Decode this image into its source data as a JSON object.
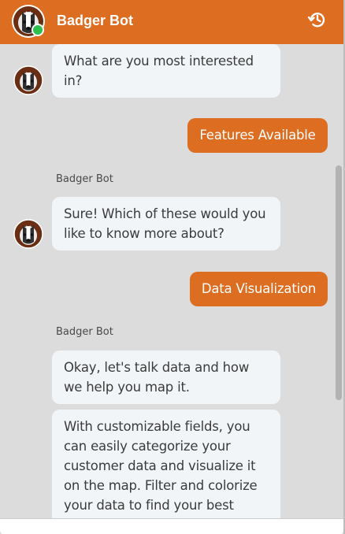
{
  "header": {
    "title": "Badger Bot",
    "icons": {
      "avatar": "badger-avatar",
      "status": "online-status-dot",
      "history": "history-clock-icon"
    },
    "colors": {
      "accent": "#dc6d21",
      "online": "#2cbf4e"
    }
  },
  "messages": [
    {
      "from": "bot",
      "text": "What are you most interested in?"
    },
    {
      "from": "user",
      "text": "Features Available"
    },
    {
      "from": "bot",
      "sender": "Badger Bot",
      "text": "Sure! Which of these would you like to know more about?"
    },
    {
      "from": "user",
      "text": "Data Visualization"
    },
    {
      "from": "bot",
      "sender": "Badger Bot",
      "text": "Okay, let's talk data and how we help you map it."
    },
    {
      "from": "bot",
      "text": "With customizable fields, you can easily categorize your customer data and visualize it on the map. Filter and colorize your data to find your best"
    }
  ]
}
